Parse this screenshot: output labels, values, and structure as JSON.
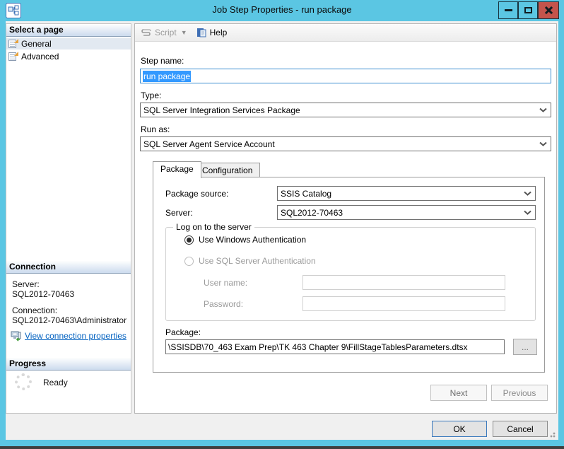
{
  "window": {
    "title": "Job Step Properties - run package"
  },
  "toolbar": {
    "script_label": "Script",
    "help_label": "Help"
  },
  "sidebar": {
    "pages_header": "Select a page",
    "pages": [
      {
        "label": "General",
        "selected": true
      },
      {
        "label": "Advanced",
        "selected": false
      }
    ],
    "connection_header": "Connection",
    "server_label": "Server:",
    "server_value": "SQL2012-70463",
    "connection_label": "Connection:",
    "connection_value": "SQL2012-70463\\Administrator",
    "view_connection_link": "View connection properties",
    "progress_header": "Progress",
    "progress_status": "Ready"
  },
  "main": {
    "step_name_label": "Step name:",
    "step_name_value": "run package",
    "type_label": "Type:",
    "type_value": "SQL Server Integration Services Package",
    "run_as_label": "Run as:",
    "run_as_value": "SQL Server Agent Service Account",
    "tabs": [
      {
        "label": "Package",
        "active": true
      },
      {
        "label": "Configuration",
        "active": false
      }
    ],
    "package_tab": {
      "package_source_label": "Package source:",
      "package_source_value": "SSIS Catalog",
      "server_label": "Server:",
      "server_value": "SQL2012-70463",
      "logon_group_title": "Log on to the server",
      "windows_auth_label": "Use Windows Authentication",
      "sql_auth_label": "Use SQL Server Authentication",
      "user_name_label": "User name:",
      "user_name_value": "",
      "password_label": "Password:",
      "password_value": "",
      "package_label": "Package:",
      "package_path": "\\SSISDB\\70_463 Exam Prep\\TK 463 Chapter 9\\FillStageTablesParameters.dtsx",
      "browse_label": "..."
    },
    "next_label": "Next",
    "previous_label": "Previous"
  },
  "footer": {
    "ok_label": "OK",
    "cancel_label": "Cancel"
  },
  "colors": {
    "titlebar": "#5bc6e3",
    "close_button": "#c4544c",
    "selection": "#3399ff",
    "link": "#0563c1"
  }
}
